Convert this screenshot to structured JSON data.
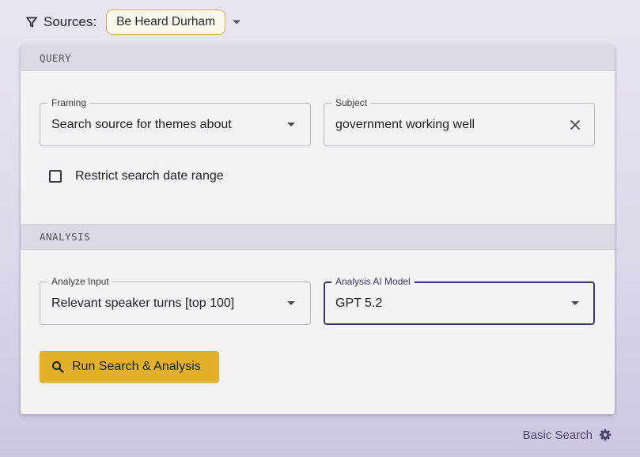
{
  "sources": {
    "label": "Sources:",
    "selected": "Be Heard Durham"
  },
  "query": {
    "header": "QUERY",
    "framing": {
      "label": "Framing",
      "value": "Search source for themes about"
    },
    "subject": {
      "label": "Subject",
      "value": "government working well"
    },
    "restrict_date": {
      "label": "Restrict search date range",
      "checked": false
    }
  },
  "analysis": {
    "header": "ANALYSIS",
    "analyze_input": {
      "label": "Analyze Input",
      "value": "Relevant speaker turns [top 100]"
    },
    "model": {
      "label": "Analysis AI Model",
      "value": "GPT 5.2"
    }
  },
  "run_button": {
    "label": "Run Search & Analysis"
  },
  "footer": {
    "basic_search_label": "Basic Search"
  },
  "colors": {
    "accent": "#e3b02a",
    "focus": "#3a3568",
    "chip_border": "#d4b04a",
    "link": "#4a4672"
  },
  "icons": {
    "filter": "filter-icon",
    "dropdown": "caret-down-icon",
    "clear": "close-icon",
    "search": "search-icon",
    "settings": "gear-icon"
  }
}
